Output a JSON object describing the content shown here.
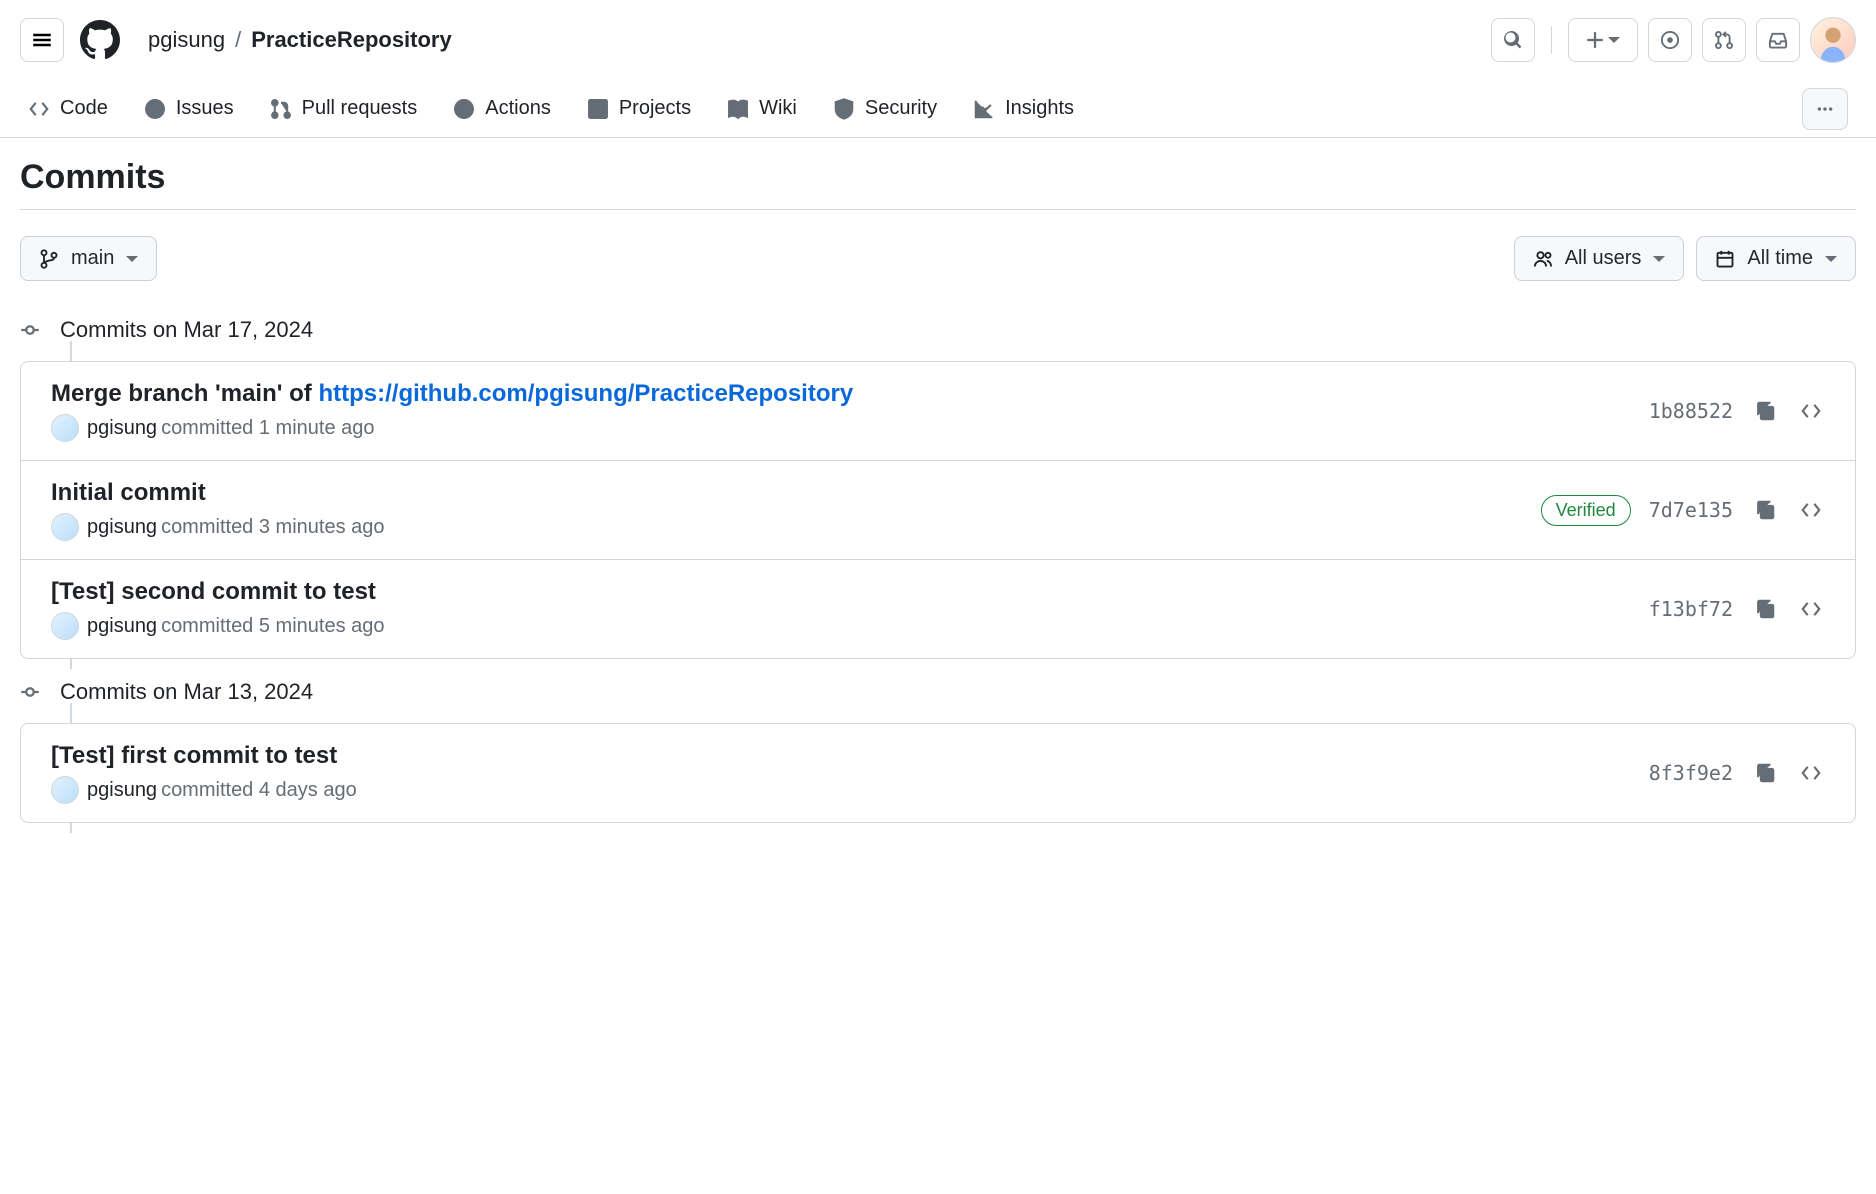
{
  "header": {
    "owner": "pgisung",
    "repo": "PracticeRepository"
  },
  "tabs": {
    "code": "Code",
    "issues": "Issues",
    "pulls": "Pull requests",
    "actions": "Actions",
    "projects": "Projects",
    "wiki": "Wiki",
    "security": "Security",
    "insights": "Insights"
  },
  "page": {
    "title": "Commits"
  },
  "filters": {
    "branch": "main",
    "users": "All users",
    "time": "All time"
  },
  "groups": [
    {
      "date_label": "Commits on Mar 17, 2024",
      "commits": [
        {
          "title_prefix": "Merge branch 'main' of ",
          "title_link": "https://github.com/pgisung/PracticeRepository",
          "author": "pgisung",
          "meta": "committed 1 minute ago",
          "sha": "1b88522",
          "verified": false
        },
        {
          "title_prefix": "Initial commit",
          "title_link": "",
          "author": "pgisung",
          "meta": "committed 3 minutes ago",
          "sha": "7d7e135",
          "verified": true
        },
        {
          "title_prefix": "[Test] second commit to test",
          "title_link": "",
          "author": "pgisung",
          "meta": "committed 5 minutes ago",
          "sha": "f13bf72",
          "verified": false
        }
      ]
    },
    {
      "date_label": "Commits on Mar 13, 2024",
      "commits": [
        {
          "title_prefix": "[Test] first commit to test",
          "title_link": "",
          "author": "pgisung",
          "meta": "committed 4 days ago",
          "sha": "8f3f9e2",
          "verified": false
        }
      ]
    }
  ],
  "labels": {
    "verified": "Verified"
  }
}
